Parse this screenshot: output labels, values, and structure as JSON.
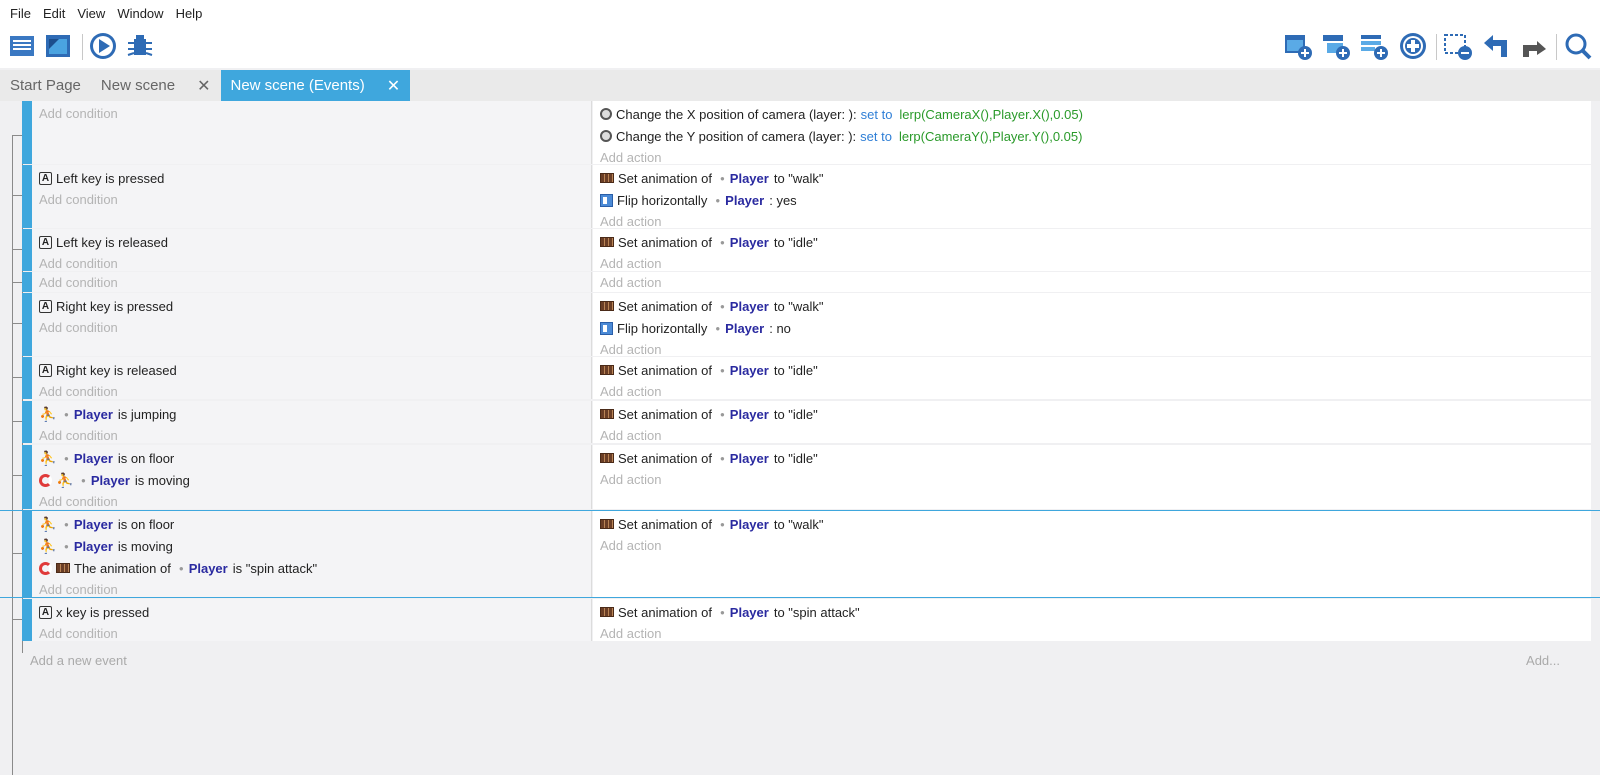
{
  "menu": [
    "File",
    "Edit",
    "View",
    "Window",
    "Help"
  ],
  "toolbar": {
    "left": [
      "project-manager-icon",
      "scene-editor-icon",
      "preview-icon",
      "debugger-icon"
    ],
    "right": [
      "add-event-icon",
      "add-subevent-icon",
      "add-comment-icon",
      "add-more-icon",
      "delete-event-icon",
      "undo-icon",
      "redo-icon",
      "search-icon"
    ]
  },
  "tabs": [
    {
      "label": "Start Page",
      "closable": false,
      "active": false
    },
    {
      "label": "New scene",
      "closable": true,
      "active": false
    },
    {
      "label": "New scene (Events)",
      "closable": true,
      "active": true
    }
  ],
  "add_condition": "Add condition",
  "add_action": "Add action",
  "add_event": "Add a new event",
  "add_more": "Add...",
  "events": [
    {
      "conditions": [],
      "actions": [
        {
          "icon": "camera",
          "text": "Change the X position of camera  (layer:  ):",
          "op": "set to",
          "expr": "lerp(CameraX(),Player.X(),0.05)"
        },
        {
          "icon": "camera",
          "text": "Change the Y position of camera  (layer:  ):",
          "op": "set to",
          "expr": "lerp(CameraY(),Player.Y(),0.05)"
        }
      ]
    },
    {
      "conditions": [
        {
          "icon": "key",
          "pre": "Left",
          "post": "key is pressed"
        }
      ],
      "actions": [
        {
          "icon": "anim",
          "text": "Set animation of",
          "obj": "Player",
          "post": "to \"walk\""
        },
        {
          "icon": "flip",
          "text": "Flip horizontally",
          "obj": "Player",
          "post": ": yes"
        }
      ]
    },
    {
      "conditions": [
        {
          "icon": "key",
          "pre": "Left",
          "post": "key is released"
        }
      ],
      "actions": [
        {
          "icon": "anim",
          "text": "Set animation of",
          "obj": "Player",
          "post": "to \"idle\""
        }
      ]
    },
    {
      "conditions": [],
      "actions": []
    },
    {
      "conditions": [
        {
          "icon": "key",
          "pre": "Right",
          "post": "key is pressed"
        }
      ],
      "actions": [
        {
          "icon": "anim",
          "text": "Set animation of",
          "obj": "Player",
          "post": "to \"walk\""
        },
        {
          "icon": "flip",
          "text": "Flip horizontally",
          "obj": "Player",
          "post": ": no"
        }
      ]
    },
    {
      "conditions": [
        {
          "icon": "key",
          "pre": "Right",
          "post": "key is released"
        }
      ],
      "actions": [
        {
          "icon": "anim",
          "text": "Set animation of",
          "obj": "Player",
          "post": "to \"idle\""
        }
      ]
    },
    {
      "conditions": [
        {
          "icon": "run",
          "obj": "Player",
          "post": "is jumping"
        }
      ],
      "actions": [
        {
          "icon": "anim",
          "text": "Set animation of",
          "obj": "Player",
          "post": "to \"idle\""
        }
      ]
    },
    {
      "conditions": [
        {
          "icon": "run",
          "obj": "Player",
          "post": "is on floor"
        },
        {
          "icon": "inv-run",
          "obj": "Player",
          "post": "is moving"
        }
      ],
      "actions": [
        {
          "icon": "anim",
          "text": "Set animation of",
          "obj": "Player",
          "post": "to \"idle\""
        }
      ]
    },
    {
      "conditions": [
        {
          "icon": "run",
          "obj": "Player",
          "post": "is on floor"
        },
        {
          "icon": "run",
          "obj": "Player",
          "post": "is moving"
        },
        {
          "icon": "inv-anim",
          "text": "The animation of",
          "obj": "Player",
          "post": "is \"spin attack\""
        }
      ],
      "actions": [
        {
          "icon": "anim",
          "text": "Set animation of",
          "obj": "Player",
          "post": "to \"walk\""
        }
      ],
      "selected": true
    },
    {
      "conditions": [
        {
          "icon": "key",
          "pre": "x",
          "post": "key is pressed"
        }
      ],
      "actions": [
        {
          "icon": "anim",
          "text": "Set animation of",
          "obj": "Player",
          "post": "to \"spin attack\""
        }
      ]
    }
  ]
}
